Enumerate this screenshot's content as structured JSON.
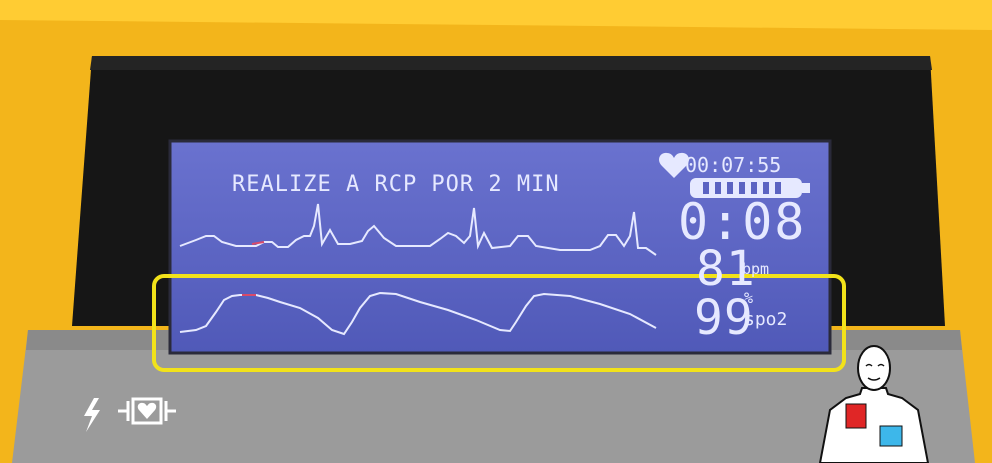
{
  "screen": {
    "prompt": "REALIZE A RCP POR 2 MIN",
    "elapsed_time": "00:07:55",
    "cpr_countdown": "0:08",
    "heart_rate": {
      "value": "81",
      "unit": "bpm"
    },
    "spo2": {
      "value": "99",
      "percent": "%",
      "unit": "spo2"
    },
    "battery_level": 1.0
  },
  "panel_icons": [
    "shock-bolt-icon",
    "defib-pads-heart-icon",
    "patient-pad-placement-icon"
  ],
  "highlight": {
    "color": "#f2e21a",
    "target": "spo2-waveform"
  },
  "colors": {
    "housing": "#f3b51b",
    "bezel": "#141414",
    "lcd": "#5b63c2",
    "lcd_text": "#e6e9ff",
    "panel": "#9a9a9a"
  }
}
